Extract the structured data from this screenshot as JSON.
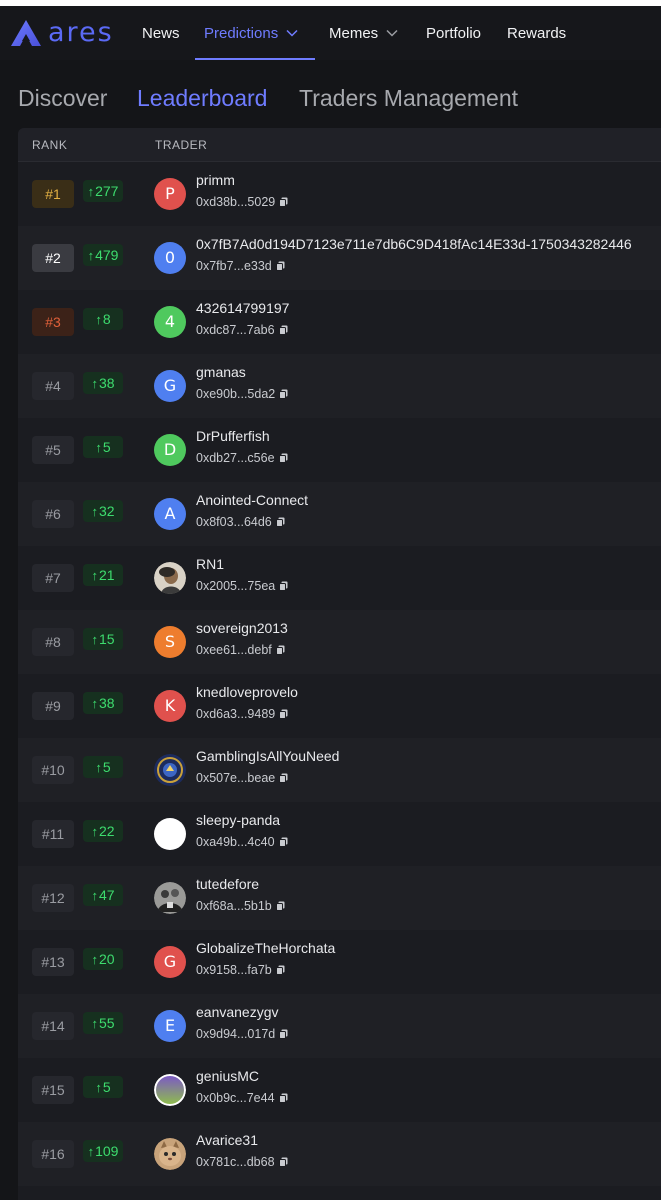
{
  "brand": {
    "name": "ares",
    "accent": "#5b6af5"
  },
  "nav": {
    "items": [
      {
        "label": "News",
        "has_chevron": false,
        "active": false
      },
      {
        "label": "Predictions",
        "has_chevron": true,
        "active": true
      },
      {
        "label": "Memes",
        "has_chevron": true,
        "active": false
      },
      {
        "label": "Portfolio",
        "has_chevron": false,
        "active": false
      },
      {
        "label": "Rewards",
        "has_chevron": false,
        "active": false
      }
    ]
  },
  "subtabs": [
    {
      "label": "Discover",
      "active": false
    },
    {
      "label": "Leaderboard",
      "active": true
    },
    {
      "label": "Traders Management",
      "active": false
    }
  ],
  "table": {
    "columns": [
      "RANK",
      "TRADER"
    ],
    "rows": [
      {
        "rank": "#1",
        "change": "277",
        "name": "primm",
        "address": "0xd38b...5029",
        "avatar_letter": "P",
        "avatar_color": "#e0514d",
        "rank_style": "gold"
      },
      {
        "rank": "#2",
        "change": "479",
        "name": "0x7fB7Ad0d194D7123e711e7db6C9D418fAc14E33d-1750343282446",
        "address": "0x7fb7...e33d",
        "avatar_letter": "0",
        "avatar_color": "#4f7ff0",
        "rank_style": "silver"
      },
      {
        "rank": "#3",
        "change": "8",
        "name": "432614799197",
        "address": "0xdc87...7ab6",
        "avatar_letter": "4",
        "avatar_color": "#4fc95e",
        "rank_style": "bronze"
      },
      {
        "rank": "#4",
        "change": "38",
        "name": "gmanas",
        "address": "0xe90b...5da2",
        "avatar_letter": "G",
        "avatar_color": "#4f7ff0",
        "rank_style": "normal"
      },
      {
        "rank": "#5",
        "change": "5",
        "name": "DrPufferfish",
        "address": "0xdb27...c56e",
        "avatar_letter": "D",
        "avatar_color": "#4fc95e",
        "rank_style": "normal"
      },
      {
        "rank": "#6",
        "change": "32",
        "name": "Anointed-Connect",
        "address": "0x8f03...64d6",
        "avatar_letter": "A",
        "avatar_color": "#4f7ff0",
        "rank_style": "normal"
      },
      {
        "rank": "#7",
        "change": "21",
        "name": "RN1",
        "address": "0x2005...75ea",
        "avatar_letter": "",
        "avatar_color": "photo-portrait",
        "rank_style": "normal"
      },
      {
        "rank": "#8",
        "change": "15",
        "name": "sovereign2013",
        "address": "0xee61...debf",
        "avatar_letter": "S",
        "avatar_color": "#ee7d2e",
        "rank_style": "normal"
      },
      {
        "rank": "#9",
        "change": "38",
        "name": "knedloveprovelo",
        "address": "0xd6a3...9489",
        "avatar_letter": "K",
        "avatar_color": "#e0514d",
        "rank_style": "normal"
      },
      {
        "rank": "#10",
        "change": "5",
        "name": "GamblingIsAllYouNeed",
        "address": "0x507e...beae",
        "avatar_letter": "",
        "avatar_color": "photo-emblem",
        "rank_style": "normal"
      },
      {
        "rank": "#11",
        "change": "22",
        "name": "sleepy-panda",
        "address": "0xa49b...4c40",
        "avatar_letter": "",
        "avatar_color": "#ffffff",
        "rank_style": "normal"
      },
      {
        "rank": "#12",
        "change": "47",
        "name": "tutedefore",
        "address": "0xf68a...5b1b",
        "avatar_letter": "",
        "avatar_color": "photo-group",
        "rank_style": "normal"
      },
      {
        "rank": "#13",
        "change": "20",
        "name": "GlobalizeTheHorchata",
        "address": "0x9158...fa7b",
        "avatar_letter": "G",
        "avatar_color": "#e0514d",
        "rank_style": "normal"
      },
      {
        "rank": "#14",
        "change": "55",
        "name": "eanvanezygv",
        "address": "0x9d94...017d",
        "avatar_letter": "E",
        "avatar_color": "#4f7ff0",
        "rank_style": "normal"
      },
      {
        "rank": "#15",
        "change": "5",
        "name": "geniusMC",
        "address": "0x0b9c...7e44",
        "avatar_letter": "",
        "avatar_color": "photo-gradient",
        "rank_style": "normal"
      },
      {
        "rank": "#16",
        "change": "109",
        "name": "Avarice31",
        "address": "0x781c...db68",
        "avatar_letter": "",
        "avatar_color": "photo-cat",
        "rank_style": "normal"
      }
    ]
  },
  "icons": {
    "rank_change": "arrow-up-icon",
    "copy": "copy-icon",
    "nav_chevron": "chevron-down-icon"
  },
  "colors": {
    "positive": "#3ddc6e",
    "active_tab": "#6f7cff"
  }
}
